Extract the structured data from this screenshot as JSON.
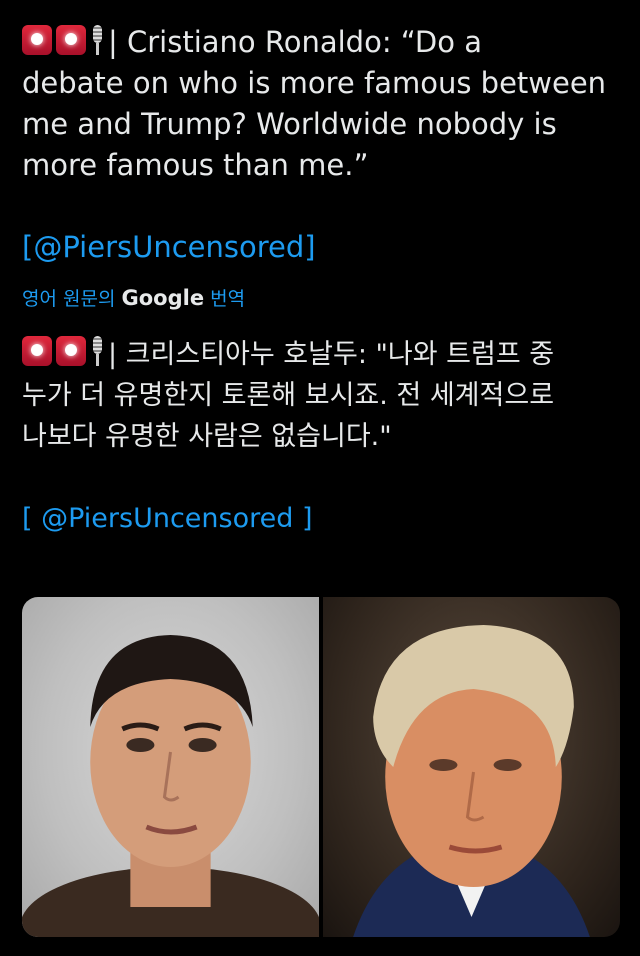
{
  "tweet": {
    "lines": [
      "| Cristiano Ronaldo: “Do a",
      "debate on who is more famous between",
      "me and Trump? Worldwide nobody is",
      "more famous than me.”"
    ],
    "link": "[@PiersUncensored]"
  },
  "translation": {
    "prefix": "영어 원문의",
    "brand": "Google",
    "suffix": "번역"
  },
  "translated": {
    "lines": [
      "| 크리스티아누 호날두: \"나와 트럼프 중",
      "누가 더 유명한지 토론해 보시죠. 전 세계적으로",
      "나보다 유명한 사람은 없습니다.\""
    ],
    "link": "[ @PiersUncensored ]"
  },
  "icons": {
    "siren": "police-light-icon",
    "mic": "studio-microphone-icon"
  },
  "colors": {
    "background": "#000000",
    "text": "#e7e9ea",
    "link": "#1d9bf0"
  }
}
